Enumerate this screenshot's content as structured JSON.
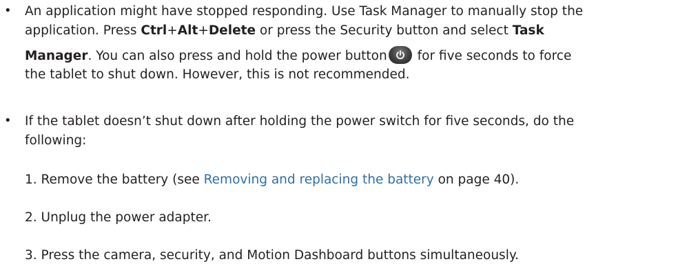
{
  "bullet1": {
    "symbol": "•",
    "l1": "An application might have stopped responding. Use Task Manager to manually stop the",
    "l2_a": "application. Press ",
    "k_ctrl": "Ctrl",
    "plus": "+",
    "k_alt": "Alt",
    "k_delete": "Delete",
    "l2_b": " or press the Security button and select ",
    "k_task": "Task",
    "k_manager": "Manager",
    "l3_a": ". You can also press and hold the power button",
    "l3_b": " for five seconds to force",
    "l4": "the tablet to shut down. However, this is not recommended."
  },
  "bullet2": {
    "symbol": "•",
    "l1": "If the tablet doesn’t shut down after holding the power switch for five seconds, do the",
    "l2": "following:"
  },
  "steps": [
    {
      "prefix": "1. Remove the battery (see ",
      "link": "Removing and replacing the battery",
      "suffix": " on page 40)."
    },
    {
      "text": "2. Unplug the power adapter."
    },
    {
      "text": "3. Press the camera, security, and Motion Dashboard buttons simultaneously."
    }
  ],
  "colors": {
    "text": "#231f20",
    "link": "#2e6fa8"
  },
  "icons": [
    "power-button-icon"
  ]
}
